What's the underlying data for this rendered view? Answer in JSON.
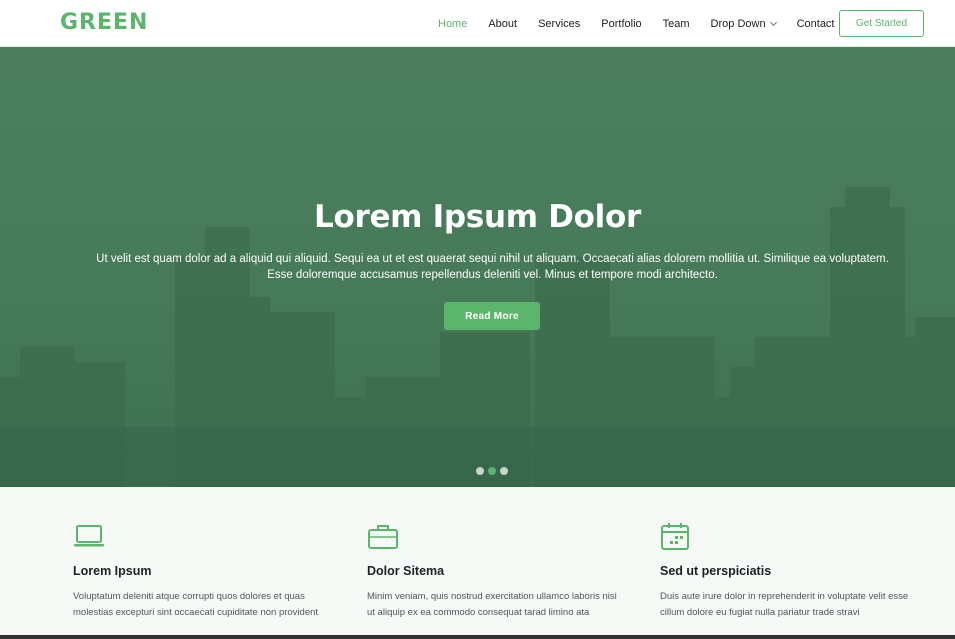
{
  "brand": {
    "logo": "GREEN",
    "accent": "#5bb56a"
  },
  "nav": {
    "items": [
      {
        "label": "Home",
        "active": true
      },
      {
        "label": "About"
      },
      {
        "label": "Services"
      },
      {
        "label": "Portfolio"
      },
      {
        "label": "Team"
      },
      {
        "label": "Drop Down",
        "dropdown": true
      },
      {
        "label": "Contact"
      }
    ],
    "cta_label": "Get Started"
  },
  "hero": {
    "title": "Lorem Ipsum Dolor",
    "text": "Ut velit est quam dolor ad a aliquid qui aliquid. Sequi ea ut et est quaerat sequi nihil ut aliquam. Occaecati alias dolorem mollitia ut. Similique ea voluptatem. Esse doloremque accusamus repellendus deleniti vel. Minus et tempore modi architecto.",
    "button_label": "Read More",
    "slides": 3,
    "active_slide": 2
  },
  "features": [
    {
      "icon": "laptop-icon",
      "title": "Lorem Ipsum",
      "text": "Voluptatum deleniti atque corrupti quos dolores et quas molestias excepturi sint occaecati cupiditate non provident"
    },
    {
      "icon": "briefcase-icon",
      "title": "Dolor Sitema",
      "text": "Minim veniam, quis nostrud exercitation ullamco laboris nisi ut aliquip ex ea commodo consequat tarad limino ata"
    },
    {
      "icon": "calendar-icon",
      "title": "Sed ut perspiciatis",
      "text": "Duis aute irure dolor in reprehenderit in voluptate velit esse cillum dolore eu fugiat nulla pariatur trade stravi"
    }
  ]
}
